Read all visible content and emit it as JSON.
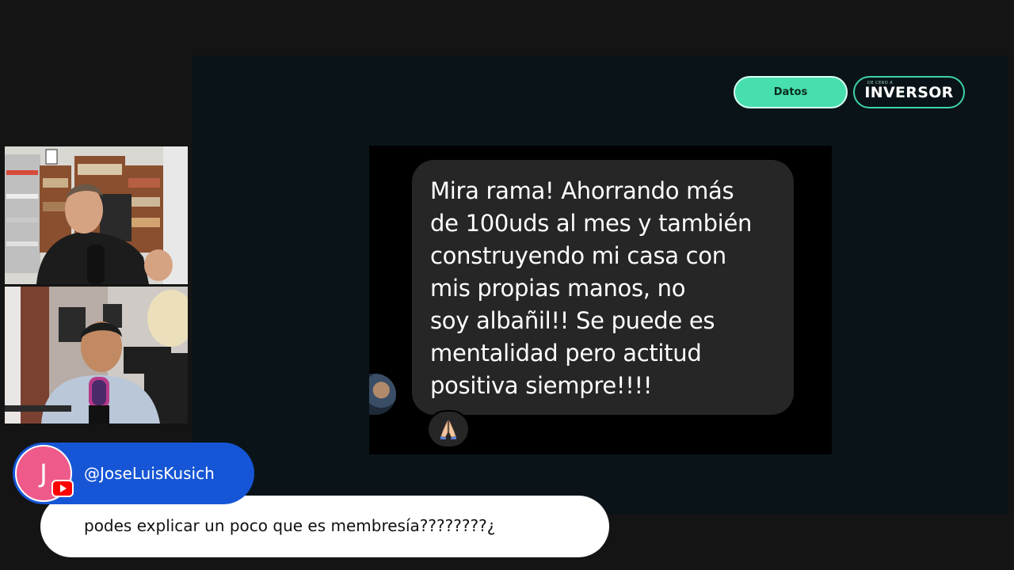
{
  "branding": {
    "datos_label": "Datos",
    "logo_small_text": "DE CERO A",
    "logo_text": "INVERSOR",
    "accent_color": "#46dfad"
  },
  "chat_message": {
    "lines": [
      "Mira rama! Ahorrando más",
      "de 100uds al mes y también",
      "construyendo mi casa con",
      "mis propias manos, no",
      "soy albañil!! Se puede es",
      "mentalidad pero actitud",
      "positiva siempre!!!!"
    ],
    "reaction_icon": "praying-hands-icon"
  },
  "comment": {
    "avatar_initial": "J",
    "username": "@JoseLuisKusich",
    "text": "podes explicar un poco que es membresía????????¿",
    "platform_icon": "youtube-icon"
  }
}
